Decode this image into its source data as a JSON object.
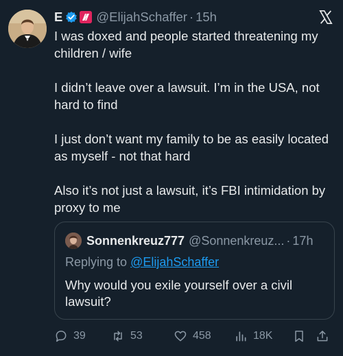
{
  "tweet": {
    "display_name": "E",
    "handle": "@ElijahSchaffer",
    "separator": "·",
    "time": "15h",
    "paragraphs": [
      "I was doxed and people started threatening my children / wife",
      "I didn’t leave over a lawsuit. I’m in the USA, not hard to find",
      "I just don’t want my family to be as easily located as myself - not that hard",
      "Also it’s not just a lawsuit, it’s FBI intimidation by proxy to me"
    ]
  },
  "quoted": {
    "display_name": "Sonnenkreuz777",
    "handle": "@Sonnenkreuz...",
    "separator": "·",
    "time": "17h",
    "replying_prefix": "Replying to",
    "replying_mention": "@ElijahSchaffer",
    "text": "Why would you exile yourself over a civil lawsuit?"
  },
  "actions": {
    "replies": "39",
    "reposts": "53",
    "likes": "458",
    "views": "18K"
  },
  "icons": {
    "verified": "verified-badge-icon",
    "affiliate": "affiliate-badge-icon",
    "logo": "x-logo-icon",
    "reply": "reply-icon",
    "repost": "repost-icon",
    "like": "heart-icon",
    "views": "views-icon",
    "bookmark": "bookmark-icon",
    "share": "share-icon"
  },
  "colors": {
    "background": "#15202b",
    "text": "#e7e9ea",
    "muted": "#8b98a5",
    "accent": "#1d9bf0",
    "border": "#38444d"
  }
}
